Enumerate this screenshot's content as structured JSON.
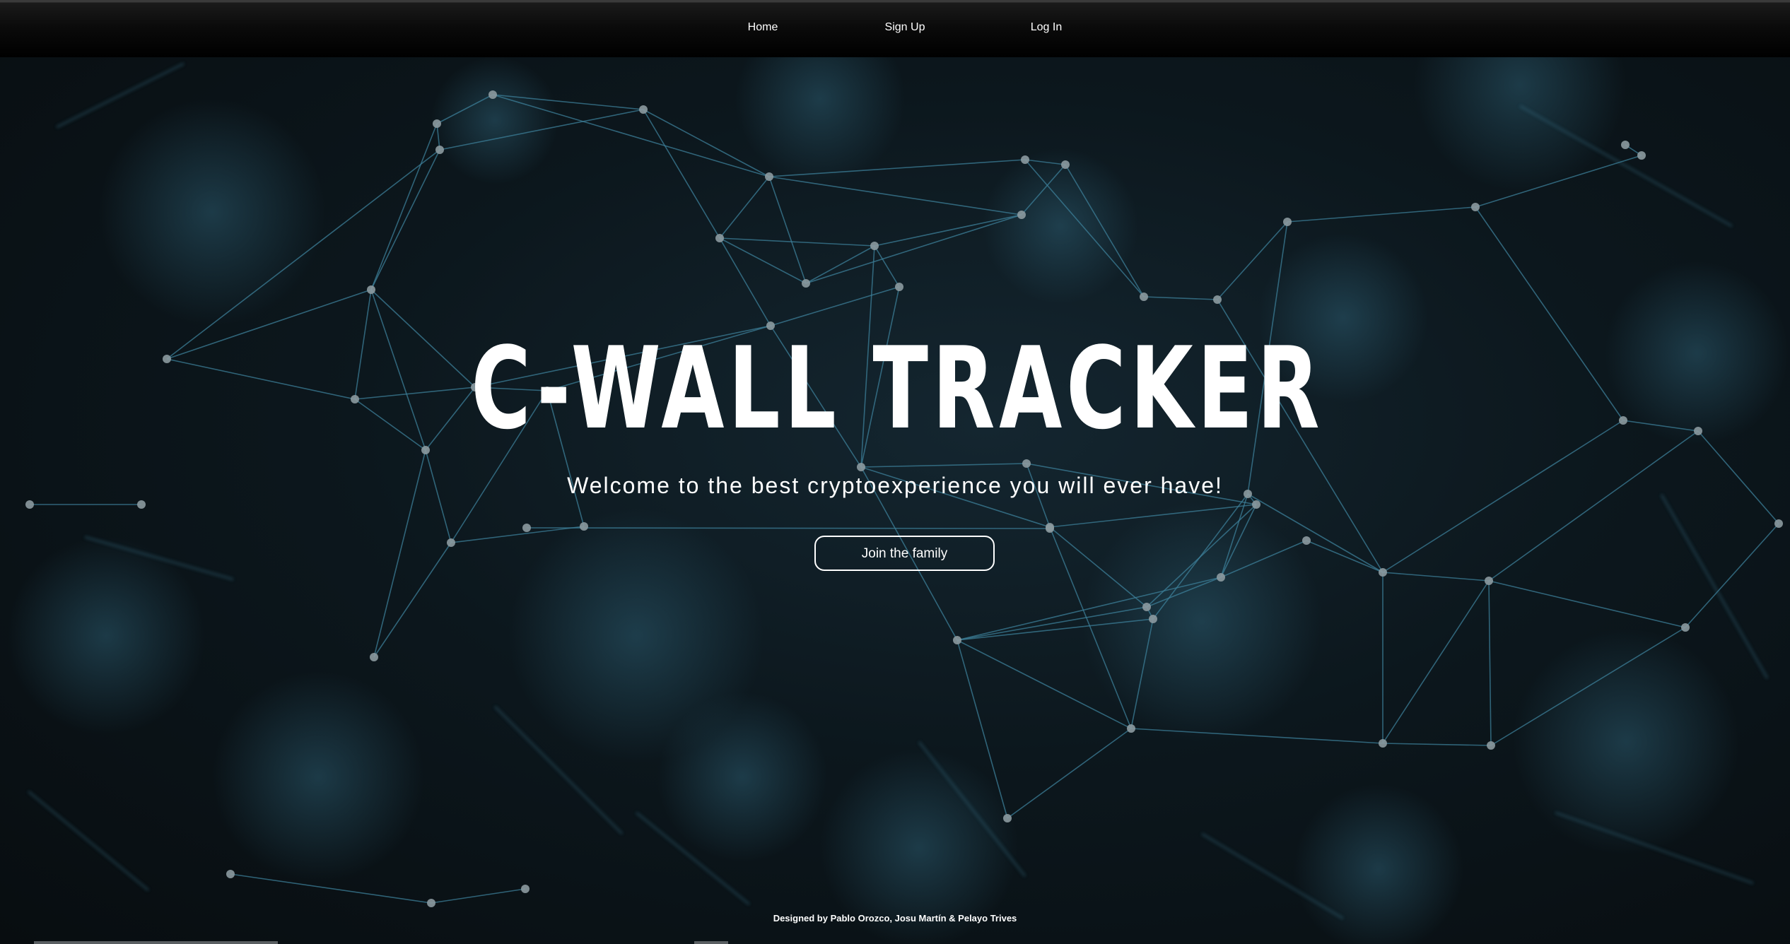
{
  "nav": {
    "items": [
      "Home",
      "Sign Up",
      "Log In"
    ]
  },
  "hero": {
    "title": "C-WALL TRACKER",
    "subtitle": "Welcome to the best cryptoexperience you will ever have!",
    "cta_label": "Join the family"
  },
  "footer": {
    "credit": "Designed by Pablo Orozco, Josu Martín & Pelayo Trives"
  },
  "colors": {
    "background": "#0b1013",
    "network_line": "#3d7f99",
    "network_node": "#8c9aa0",
    "text": "#ffffff"
  }
}
